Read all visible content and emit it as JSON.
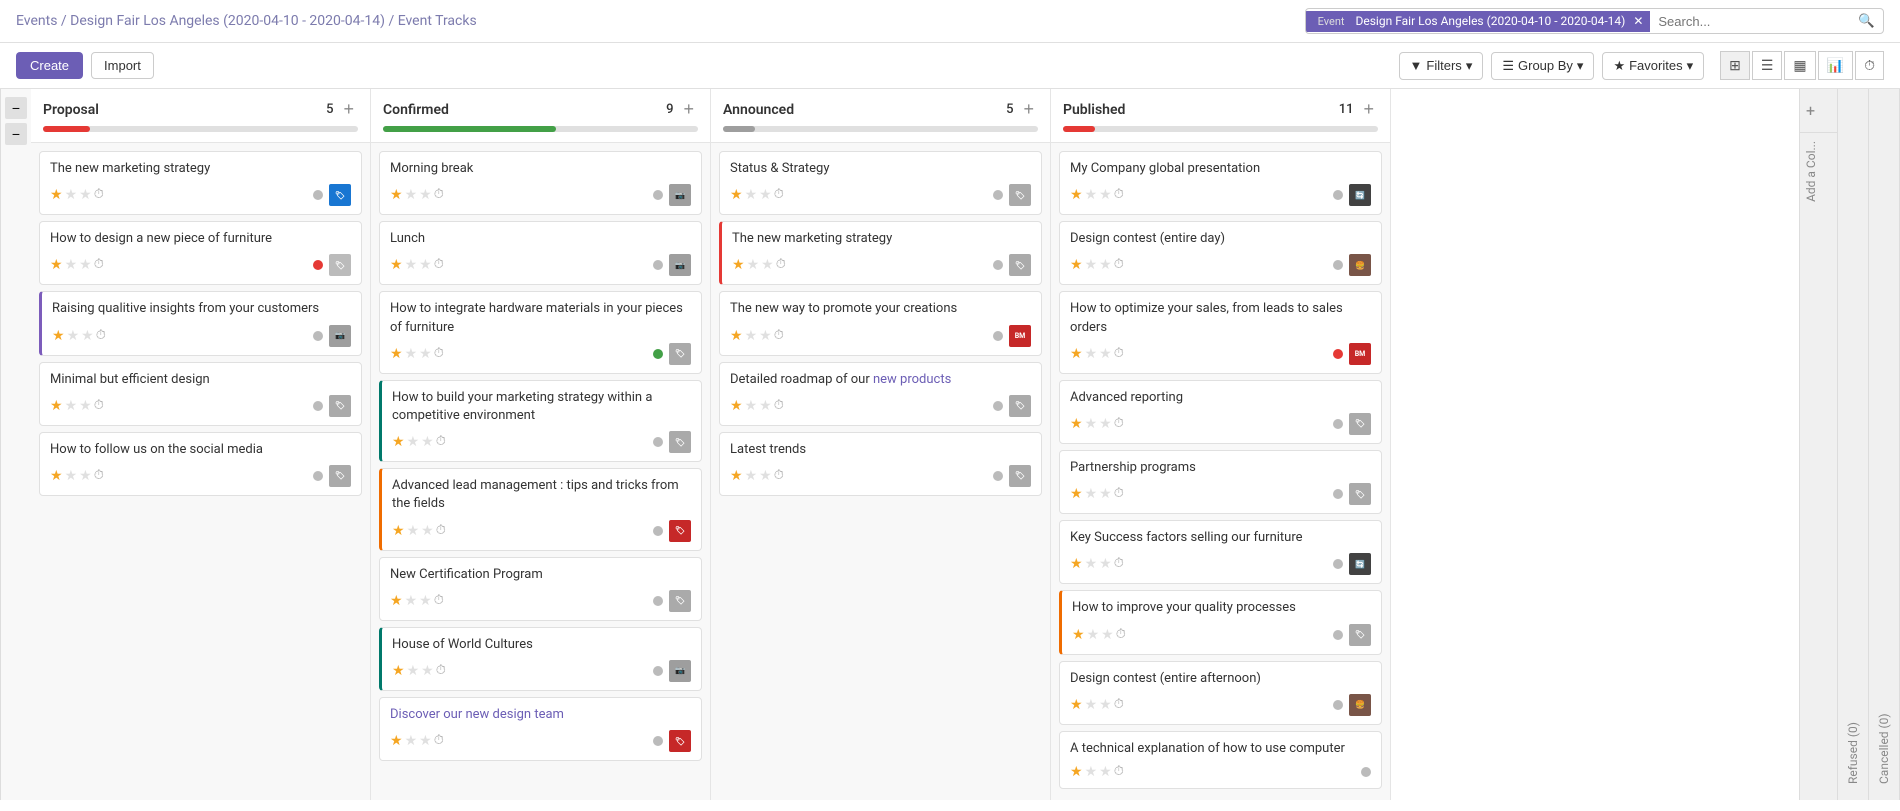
{
  "breadcrumb": {
    "parts": [
      "Events",
      "Design Fair Los Angeles (2020-04-10 - 2020-04-14)",
      "Event Tracks"
    ]
  },
  "search": {
    "event_tag": "Design Fair Los Angeles (2020-04-10 - 2020-04-14)",
    "placeholder": "Search..."
  },
  "toolbar": {
    "create_label": "Create",
    "import_label": "Import",
    "filters_label": "Filters",
    "group_by_label": "Group By",
    "favorites_label": "Favorites"
  },
  "columns": [
    {
      "id": "proposal",
      "title": "Proposal",
      "count": 5,
      "progress_color": "#e53935",
      "progress_pct": 15,
      "cards": [
        {
          "id": 1,
          "title": "The new marketing strategy",
          "stars": 1,
          "dot": null,
          "avatar_type": "tag",
          "left_border": null
        },
        {
          "id": 2,
          "title": "How to design a new piece of furniture",
          "stars": 1,
          "dot": "red",
          "avatar_type": "tag",
          "left_border": null
        },
        {
          "id": 3,
          "title": "Raising qualitive insights from your customers",
          "stars": 1,
          "dot": null,
          "avatar_type": "cam",
          "left_border": "purple"
        },
        {
          "id": 4,
          "title": "Minimal but efficient design",
          "stars": 1,
          "dot": null,
          "avatar_type": "tag_small",
          "left_border": null
        },
        {
          "id": 5,
          "title": "How to follow us on the social media",
          "stars": 1,
          "dot": null,
          "avatar_type": "tag_small",
          "left_border": null
        }
      ]
    },
    {
      "id": "confirmed",
      "title": "Confirmed",
      "count": 9,
      "progress_color": "#43a047",
      "progress_pct": 55,
      "cards": [
        {
          "id": 10,
          "title": "Morning break",
          "stars": 1,
          "dot": null,
          "avatar_type": "cam",
          "left_border": null
        },
        {
          "id": 11,
          "title": "Lunch",
          "stars": 1,
          "dot": null,
          "avatar_type": "cam",
          "left_border": null
        },
        {
          "id": 12,
          "title": "How to integrate hardware materials in your pieces of furniture",
          "stars": 1,
          "dot": "green",
          "avatar_type": "tag",
          "left_border": null,
          "has_menu": true
        },
        {
          "id": 13,
          "title": "How to build your marketing strategy within a competitive environment",
          "stars": 1,
          "dot": null,
          "avatar_type": "tag",
          "left_border": "teal"
        },
        {
          "id": 14,
          "title": "Advanced lead management : tips and tricks from the fields",
          "stars": 1,
          "dot": null,
          "avatar_type": "tag_red",
          "left_border": "orange"
        },
        {
          "id": 15,
          "title": "New Certification Program",
          "stars": 1,
          "dot": null,
          "avatar_type": "tag_small",
          "left_border": null
        },
        {
          "id": 16,
          "title": "House of World Cultures",
          "stars": 1,
          "dot": null,
          "avatar_type": "cam",
          "left_border": "teal"
        },
        {
          "id": 17,
          "title": "Discover our new design team",
          "stars": 1,
          "dot": null,
          "avatar_type": "tag_red",
          "left_border": null
        }
      ]
    },
    {
      "id": "announced",
      "title": "Announced",
      "count": 5,
      "progress_color": "#9e9e9e",
      "progress_pct": 10,
      "cards": [
        {
          "id": 20,
          "title": "Status & Strategy",
          "stars": 1,
          "dot": null,
          "avatar_type": "tag",
          "left_border": null
        },
        {
          "id": 21,
          "title": "The new marketing strategy",
          "stars": 1,
          "dot": null,
          "avatar_type": "tag",
          "left_border": "red"
        },
        {
          "id": 22,
          "title": "The new way to promote your creations",
          "stars": 1,
          "dot": null,
          "avatar_type": "tag_brand",
          "left_border": null
        },
        {
          "id": 23,
          "title": "Detailed roadmap of our new products",
          "stars": 1,
          "dot": null,
          "avatar_type": "tag_small",
          "left_border": null
        },
        {
          "id": 24,
          "title": "Latest trends",
          "stars": 1,
          "dot": null,
          "avatar_type": "tag",
          "left_border": null
        }
      ]
    },
    {
      "id": "published",
      "title": "Published",
      "count": 11,
      "progress_color": "#e53935",
      "progress_pct": 10,
      "cards": [
        {
          "id": 30,
          "title": "My Company global presentation",
          "stars": 1,
          "dot": null,
          "avatar_type": "cycle",
          "left_border": null
        },
        {
          "id": 31,
          "title": "Design contest (entire day)",
          "stars": 1,
          "dot": null,
          "avatar_type": "food",
          "left_border": null
        },
        {
          "id": 32,
          "title": "How to optimize your sales, from leads to sales orders",
          "stars": 1,
          "dot": "red",
          "avatar_type": "tag_brand",
          "left_border": null
        },
        {
          "id": 33,
          "title": "Advanced reporting",
          "stars": 1,
          "dot": null,
          "avatar_type": "tag_small2",
          "left_border": null
        },
        {
          "id": 34,
          "title": "Partnership programs",
          "stars": 1,
          "dot": null,
          "avatar_type": "tag_multi",
          "left_border": null
        },
        {
          "id": 35,
          "title": "Key Success factors selling our furniture",
          "stars": 1,
          "dot": null,
          "avatar_type": "cycle",
          "left_border": null
        },
        {
          "id": 36,
          "title": "How to improve your quality processes",
          "stars": 1,
          "dot": null,
          "avatar_type": "tag_small2",
          "left_border": "orange"
        },
        {
          "id": 37,
          "title": "Design contest (entire afternoon)",
          "stars": 1,
          "dot": null,
          "avatar_type": "food",
          "left_border": null
        },
        {
          "id": 38,
          "title": "A technical explanation of how to use computer",
          "stars": 1,
          "dot": null,
          "avatar_type": null,
          "left_border": null
        }
      ]
    }
  ],
  "collapsed_columns": [
    {
      "id": "refused",
      "label": "Refused (0)"
    },
    {
      "id": "cancelled",
      "label": "Cancelled (0)"
    }
  ],
  "add_col_label": "Add a Col...",
  "icons": {
    "filter": "▼",
    "group_by": "☰",
    "favorites": "★",
    "search": "🔍",
    "kanban": "⊞",
    "list": "☰",
    "calendar": "📅",
    "chart": "📊",
    "clock": "⏱",
    "add": "+",
    "chevron_down": "▾",
    "minus": "−",
    "three_dots": "⋮"
  }
}
